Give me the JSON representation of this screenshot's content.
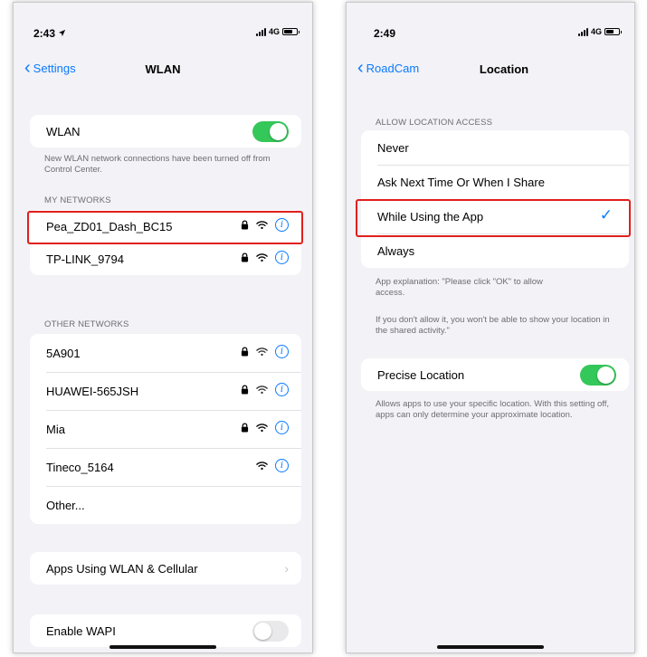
{
  "left_screen": {
    "status": {
      "time": "2:43",
      "network": "4G"
    },
    "nav": {
      "back_label": "Settings",
      "title": "WLAN"
    },
    "wlan": {
      "label": "WLAN",
      "enabled": true
    },
    "wlan_footnote": "New WLAN network connections have been turned off from Control Center.",
    "my_networks_header": "MY NETWORKS",
    "my_networks": [
      {
        "name": "Pea_ZD01_Dash_BC15",
        "locked": true
      },
      {
        "name": "TP-LINK_9794",
        "locked": true
      }
    ],
    "other_networks_header": "OTHER NETWORKS",
    "other_networks": [
      {
        "name": "5A901",
        "locked": true
      },
      {
        "name": "HUAWEI-565JSH",
        "locked": true
      },
      {
        "name": "Mia",
        "locked": true
      },
      {
        "name": "Tineco_5164",
        "locked": false
      }
    ],
    "other_label": "Other...",
    "apps_using_label": "Apps Using WLAN & Cellular",
    "wapi": {
      "label": "Enable WAPI",
      "enabled": false
    }
  },
  "right_screen": {
    "status": {
      "time": "2:49",
      "network": "4G"
    },
    "nav": {
      "back_label": "RoadCam",
      "title": "Location"
    },
    "access_header": "ALLOW LOCATION ACCESS",
    "options": [
      "Never",
      "Ask Next Time Or When I Share",
      "While Using the App",
      "Always"
    ],
    "selected_option": "While Using the App",
    "app_explanation": "App explanation: \"Please click \"OK\" to allow access.",
    "app_explanation_2": "If you don't allow it, you won't be able to show your location in the shared activity.\"",
    "precise": {
      "label": "Precise Location",
      "enabled": true
    },
    "precise_footnote": "Allows apps to use your specific location. With this setting off, apps can only determine your approximate location."
  },
  "colors": {
    "accent": "#0a7aff",
    "toggle_on": "#34c759",
    "highlight": "#e0201d",
    "background": "#f2f2f7"
  },
  "icons": [
    "back-chevron-icon",
    "lock-icon",
    "wifi-icon",
    "info-icon",
    "chevron-right-icon",
    "checkmark-icon",
    "location-arrow-icon",
    "signal-icon",
    "battery-icon"
  ]
}
